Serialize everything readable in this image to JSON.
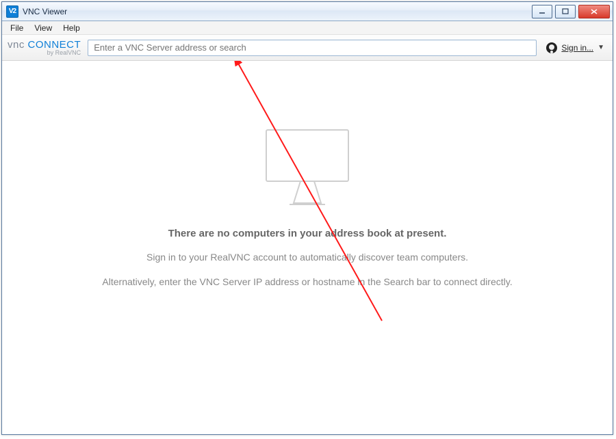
{
  "window": {
    "title": "VNC Viewer"
  },
  "menu": {
    "file": "File",
    "view": "View",
    "help": "Help"
  },
  "brand": {
    "top_vnc": "vnc",
    "top_connect": " CONNECT",
    "sub": "by RealVNC"
  },
  "search": {
    "placeholder": "Enter a VNC Server address or search"
  },
  "signin": {
    "label": "Sign in..."
  },
  "empty": {
    "title": "There are no computers in your address book at present.",
    "line1": "Sign in to your RealVNC account to automatically discover team computers.",
    "line2": "Alternatively, enter the VNC Server IP address or hostname in the Search bar to connect directly."
  },
  "app_icon_text": "V2"
}
